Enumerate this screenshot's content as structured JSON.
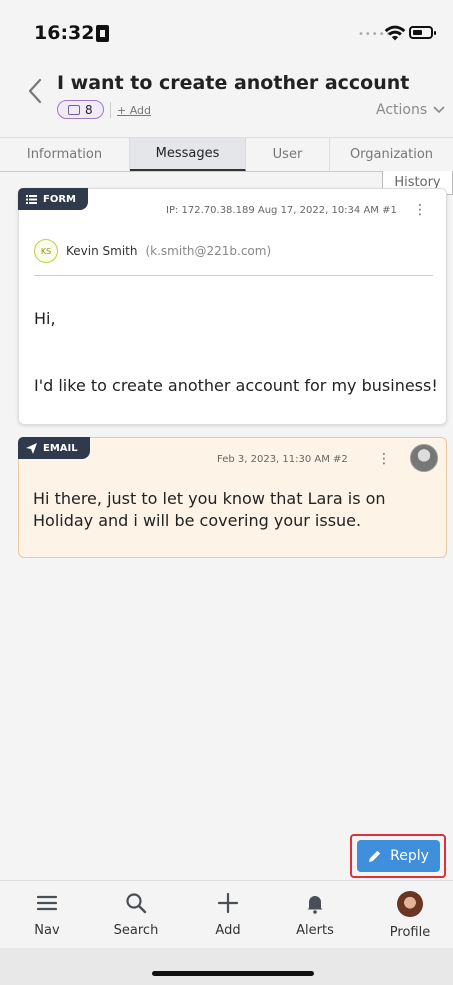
{
  "status_bar": {
    "time": "16:32"
  },
  "ticket": {
    "title": "I want to create another account",
    "badge_count": "8",
    "add_label": "+ Add",
    "actions_label": "Actions"
  },
  "tabs": [
    {
      "label": "Information",
      "active": false
    },
    {
      "label": "Messages",
      "active": true
    },
    {
      "label": "User",
      "active": false
    },
    {
      "label": "Organization",
      "active": false
    }
  ],
  "history_label": "History",
  "messages": [
    {
      "type_label": "FORM",
      "meta": "IP: 172.70.38.189  Aug 17, 2022, 10:34 AM  #1",
      "sender_initials": "KS",
      "sender_name": "Kevin Smith",
      "sender_email": "(k.smith@221b.com)",
      "lines": [
        "Hi,",
        "I'd like to create another account for my business!"
      ]
    },
    {
      "type_label": "EMAIL",
      "meta": "Feb 3, 2023, 11:30 AM    #2",
      "body": "Hi there, just to let you know that Lara is on Holiday and i will be covering your issue."
    }
  ],
  "reply_label": "Reply",
  "bottom_nav": [
    {
      "label": "Nav",
      "icon": "menu-icon"
    },
    {
      "label": "Search",
      "icon": "search-icon"
    },
    {
      "label": "Add",
      "icon": "plus-icon"
    },
    {
      "label": "Alerts",
      "icon": "bell-icon"
    },
    {
      "label": "Profile",
      "icon": "avatar"
    }
  ],
  "colors": {
    "reply_button": "#3f8fdc",
    "highlight_outline": "#e0303a",
    "email_card_bg": "#fdf3e7",
    "tag_bg": "#2f3b4d"
  }
}
